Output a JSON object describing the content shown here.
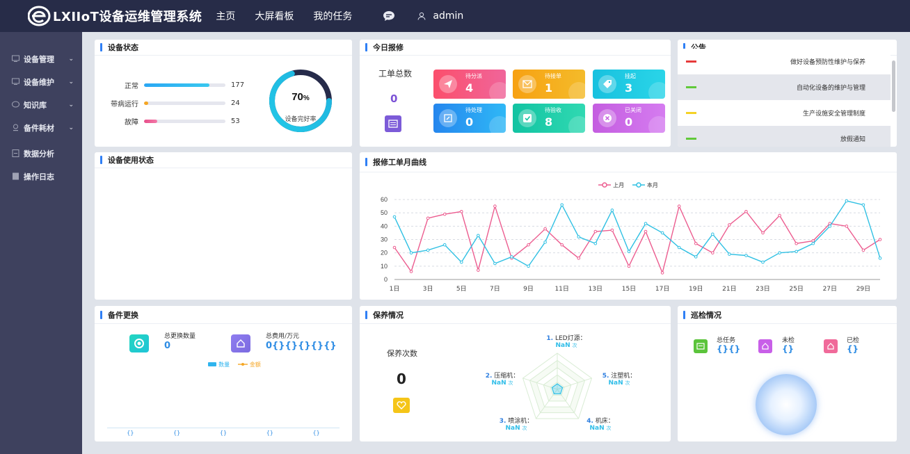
{
  "app": {
    "title": "LXIIoT设备运维管理系统"
  },
  "nav": [
    {
      "label": "主页"
    },
    {
      "label": "大屏看板"
    },
    {
      "label": "我的任务"
    }
  ],
  "user": {
    "name": "admin"
  },
  "sidebar": [
    {
      "label": "设备管理",
      "icon": "monitor-icon",
      "chevron": "⌄"
    },
    {
      "label": "设备维护",
      "icon": "monitor-icon",
      "chevron": "⌄"
    },
    {
      "label": "知识库",
      "icon": "chat-icon",
      "chevron": "⌄"
    },
    {
      "label": "备件耗材",
      "icon": "person-icon",
      "chevron": "⌄"
    },
    {
      "label": "数据分析",
      "icon": "document-icon"
    },
    {
      "label": "操作日志",
      "icon": "book-icon"
    }
  ],
  "device_status": {
    "title": "设备状态",
    "rows": [
      {
        "label": "正常",
        "value": "177",
        "fraction": 0.8,
        "color": "#2db3f2"
      },
      {
        "label": "带病运行",
        "value": "24",
        "fraction": 0.05,
        "color": "#f5a623"
      },
      {
        "label": "故障",
        "value": "53",
        "fraction": 0.16,
        "color": "#f0508a"
      }
    ],
    "gauge_value": "70",
    "gauge_unit": "%",
    "gauge_fraction": 0.7,
    "gauge_label": "设备完好率"
  },
  "repair_today": {
    "title": "今日报修",
    "total_label": "工单总数",
    "total_value": "0",
    "tiles": [
      {
        "label": "待分派",
        "value": "4",
        "from": "#fb4f6c",
        "to": "#f0659a",
        "icon": "send-icon"
      },
      {
        "label": "待接单",
        "value": "1",
        "from": "#f7a112",
        "to": "#f4bb2a",
        "icon": "envelope-icon"
      },
      {
        "label": "挂起",
        "value": "3",
        "from": "#18c1df",
        "to": "#2ad5e8",
        "icon": "tag-icon"
      },
      {
        "label": "待处理",
        "value": "0",
        "from": "#2586ee",
        "to": "#2fb8f6",
        "icon": "edit-icon"
      },
      {
        "label": "待验收",
        "value": "8",
        "from": "#12c3a2",
        "to": "#30d9b2",
        "icon": "check-icon"
      },
      {
        "label": "已关闭",
        "value": "0",
        "from": "#c45de0",
        "to": "#d57cf0",
        "icon": "close-icon"
      }
    ]
  },
  "notice": {
    "title": "公告",
    "items": [
      {
        "text": "做好设备预防性维护与保养",
        "color": "#e63b3b"
      },
      {
        "text": "自动化设备的维护与管理",
        "color": "#61c93a"
      },
      {
        "text": "生产设施安全管理制度",
        "color": "#f5d226"
      },
      {
        "text": "放假通知",
        "color": "#61c93a"
      }
    ]
  },
  "usage": {
    "title": "设备使用状态"
  },
  "curve": {
    "title": "报修工单月曲线"
  },
  "chart_data": {
    "type": "line",
    "title": "",
    "legend_position": "top-center",
    "grid": true,
    "x": [
      "1日",
      "2日",
      "3日",
      "4日",
      "5日",
      "6日",
      "7日",
      "8日",
      "9日",
      "10日",
      "11日",
      "12日",
      "13日",
      "14日",
      "15日",
      "16日",
      "17日",
      "18日",
      "19日",
      "20日",
      "21日",
      "22日",
      "23日",
      "24日",
      "25日",
      "26日",
      "27日",
      "28日",
      "29日",
      "30日"
    ],
    "x_tick_labels": [
      "1日",
      "3日",
      "5日",
      "7日",
      "9日",
      "11日",
      "13日",
      "15日",
      "17日",
      "19日",
      "21日",
      "23日",
      "25日",
      "27日",
      "29日"
    ],
    "ylim": [
      0,
      60
    ],
    "y_ticks": [
      "0",
      "10",
      "20",
      "30",
      "40",
      "50",
      "60"
    ],
    "series": [
      {
        "name": "上月",
        "color": "#ec5c8f",
        "values": [
          24,
          6,
          46,
          49,
          51,
          7,
          55,
          16,
          26,
          38,
          26,
          16,
          36,
          37,
          10,
          36,
          5,
          55,
          27,
          20,
          41,
          51,
          35,
          48,
          27,
          29,
          42,
          40,
          22,
          30
        ]
      },
      {
        "name": "本月",
        "color": "#2fc0e3",
        "values": [
          47,
          20,
          22,
          26,
          13,
          33,
          12,
          17,
          10,
          28,
          56,
          32,
          27,
          52,
          21,
          42,
          35,
          24,
          17,
          34,
          19,
          18,
          13,
          20,
          21,
          27,
          40,
          59,
          56,
          16
        ]
      }
    ]
  },
  "spares": {
    "title": "备件更换",
    "count_label": "总更换数量",
    "count_value": "0",
    "cost_label": "总费用/万元",
    "cost_value": "0{}{}{}{}{}",
    "legend_qty": "数量",
    "legend_amount": "金额",
    "axis_labels": [
      "{}",
      "{}",
      "{}",
      "{}",
      "{}"
    ]
  },
  "maintenance": {
    "title": "保养情况",
    "count_label": "保养次数",
    "count_value": "0",
    "unit": "次",
    "items": [
      {
        "num": "1.",
        "name": "LED灯源：",
        "value": "NaN"
      },
      {
        "num": "2.",
        "name": "压缩机：",
        "value": "NaN"
      },
      {
        "num": "3.",
        "name": "喷涂机：",
        "value": "NaN"
      },
      {
        "num": "4.",
        "name": "机床：",
        "value": "NaN"
      },
      {
        "num": "5.",
        "name": "注塑机：",
        "value": "NaN"
      }
    ]
  },
  "inspection": {
    "title": "巡检情况",
    "total_label": "总任务",
    "total_value": "{}{}",
    "pending_label": "未检",
    "pending_value": "{}",
    "done_label": "已检",
    "done_value": "{}"
  }
}
